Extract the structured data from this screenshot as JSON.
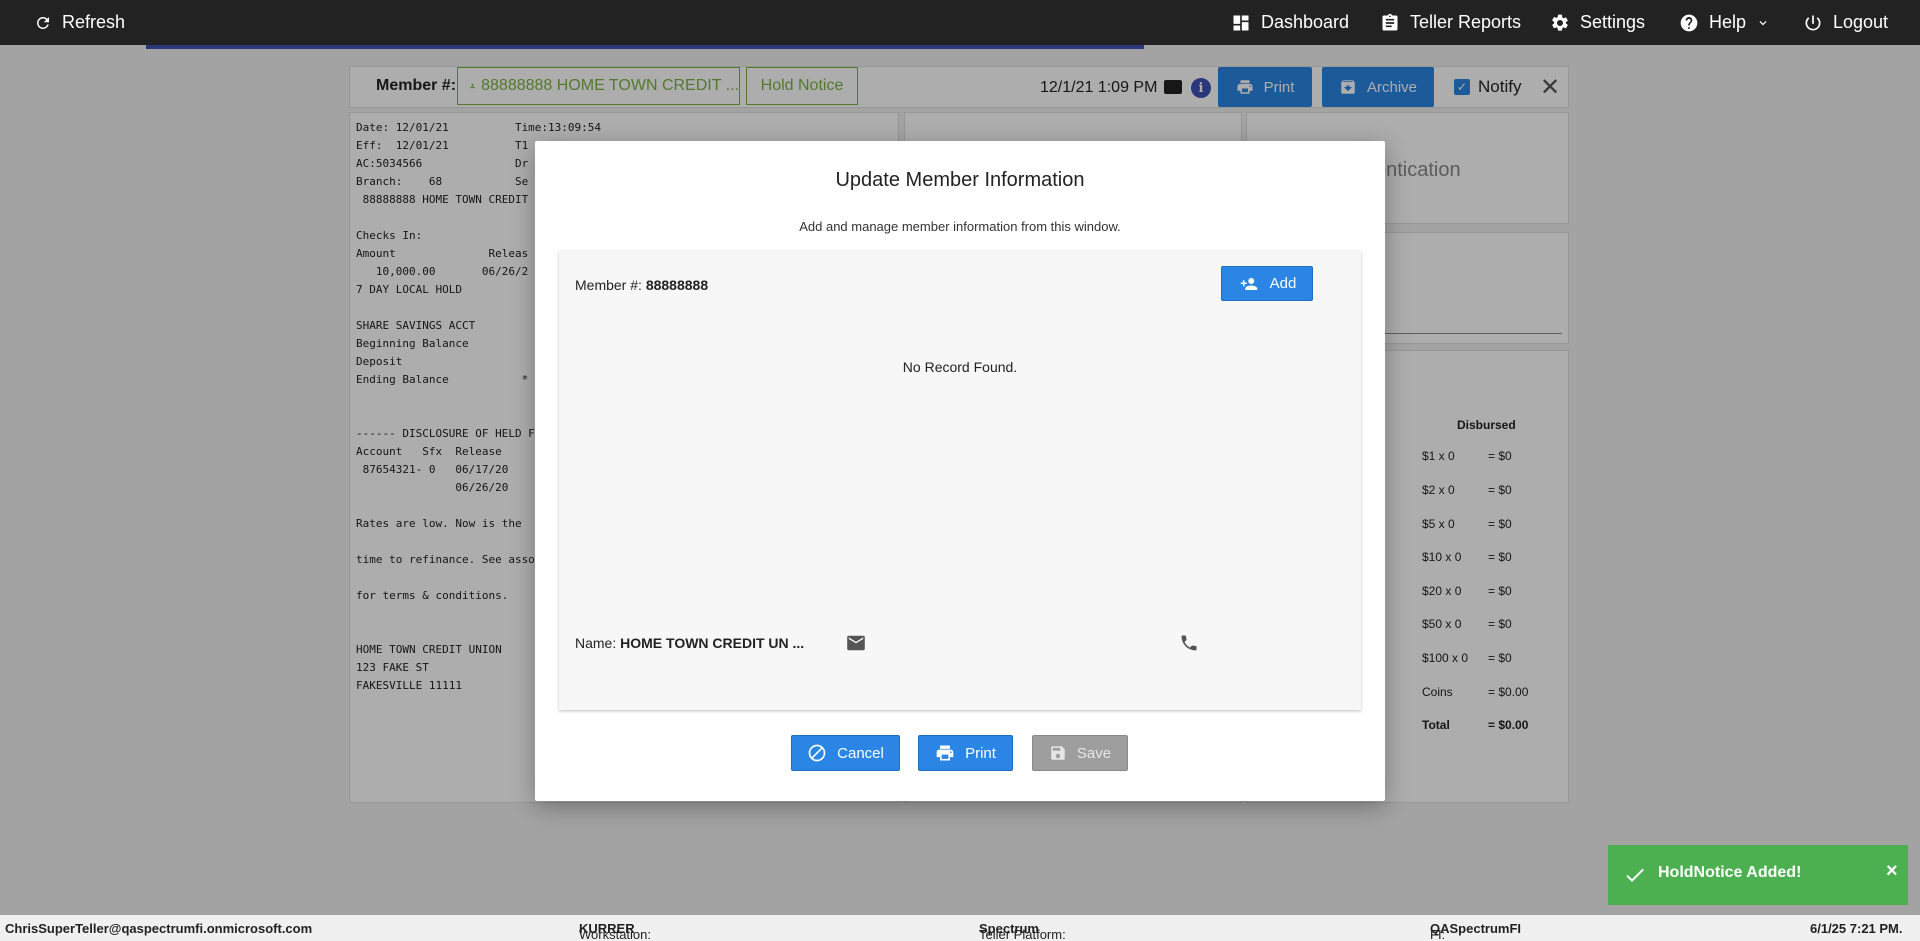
{
  "topbar": {
    "refresh": "Refresh",
    "dashboard": "Dashboard",
    "teller_reports": "Teller Reports",
    "settings": "Settings",
    "help": "Help",
    "logout": "Logout"
  },
  "toolbar": {
    "member_label": "Member #:",
    "member_value": "88888888 HOME TOWN CREDIT ...",
    "hold_notice": "Hold Notice",
    "datetime": "12/1/21 1:09 PM",
    "print": "Print",
    "archive": "Archive",
    "notify": "Notify"
  },
  "receipt": {
    "text": "Date: 12/01/21          Time:13:09:54\nEff:  12/01/21          T1\nAC:5034566              Dr\nBranch:    68           Se\n 88888888 HOME TOWN CREDIT\n\nChecks In:\nAmount              Releas\n   10,000.00       06/26/2\n7 DAY LOCAL HOLD\n\nSHARE SAVINGS ACCT\nBeginning Balance\nDeposit\nEnding Balance           *\n\n\n------ DISCLOSURE OF HELD F\nAccount   Sfx  Release\n 87654321- 0   06/17/20\n               06/26/20\n\nRates are low. Now is the\n\ntime to refinance. See asso\n\nfor terms & conditions.\n\n\nHOME TOWN CREDIT UNION\n123 FAKE ST\nFAKESVILLE 11111"
  },
  "right_panel": {
    "auth_partial": "entication",
    "disbursed_header": "Disbursed",
    "rows": [
      {
        "denom": "$1 x 0",
        "amount": "= $0"
      },
      {
        "denom": "$2 x 0",
        "amount": "= $0"
      },
      {
        "denom": "$5 x 0",
        "amount": "= $0"
      },
      {
        "denom": "$10 x 0",
        "amount": "= $0"
      },
      {
        "denom": "$20 x 0",
        "amount": "= $0"
      },
      {
        "denom": "$50 x 0",
        "amount": "= $0"
      },
      {
        "denom": "$100 x 0",
        "amount": "= $0"
      },
      {
        "denom": "Coins",
        "amount": "= $0.00"
      },
      {
        "denom": "Total",
        "amount": "= $0.00"
      }
    ]
  },
  "modal": {
    "title": "Update Member Information",
    "subtitle": "Add and manage member information from this window.",
    "member_label": "Member #:",
    "member_value": "88888888",
    "add": "Add",
    "no_record": "No Record Found.",
    "name_label": "Name:",
    "name_value": "HOME TOWN CREDIT UN ...",
    "cancel": "Cancel",
    "print": "Print",
    "save": "Save"
  },
  "statusbar": {
    "user": "ChrisSuperTeller@qaspectrumfi.onmicrosoft.com",
    "workstation_label": "Workstation:",
    "workstation": "KURRER",
    "platform_label": "Teller Platform:",
    "platform": "Spectrum",
    "fi_label": "FI:",
    "fi": "QASpectrumFI",
    "datetime": "6/1/25 7:21 PM."
  },
  "toast": {
    "message": "HoldNotice Added!",
    "close": "×"
  },
  "colors": {
    "primary": "#2b85e4",
    "topbar": "#222222",
    "success": "#4caf50",
    "chip_green": "#7cb342",
    "progress": "#3f51b5"
  }
}
